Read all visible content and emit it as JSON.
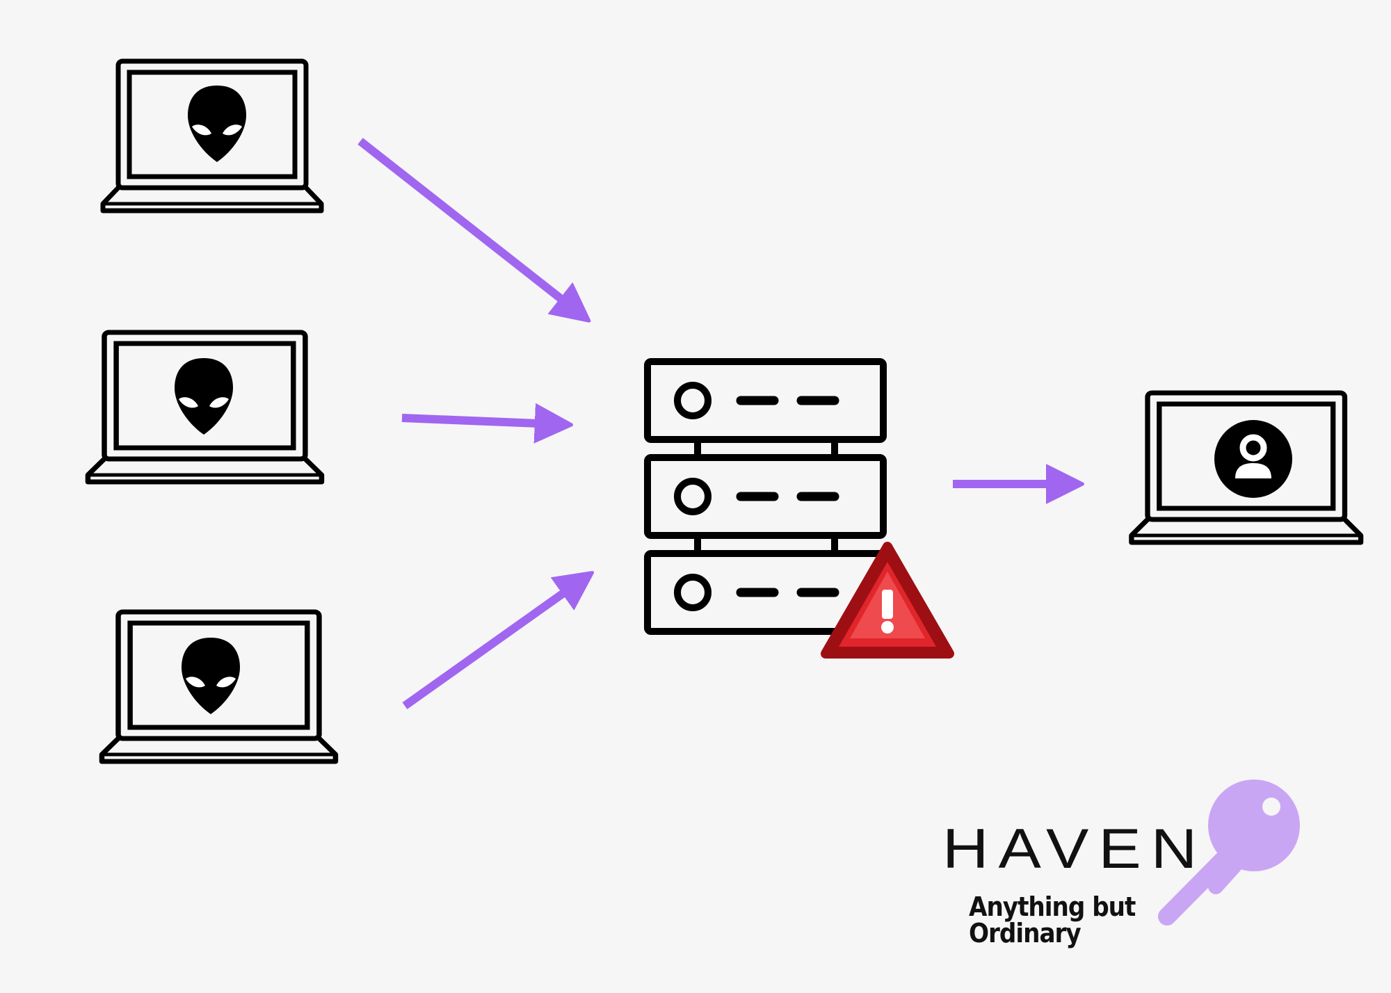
{
  "brand": {
    "name": "HAVEN",
    "tagline": "Anything but Ordinary"
  },
  "colors": {
    "background": "#f6f6f6",
    "arrow": "#a066f0",
    "key": "#c9a6f3",
    "warning": "#e0262b",
    "ink": "#000000"
  },
  "icons": {
    "attacker": "alien-icon",
    "server": "server-rack-icon",
    "alert": "warning-triangle-icon",
    "victim": "user-avatar-icon"
  }
}
